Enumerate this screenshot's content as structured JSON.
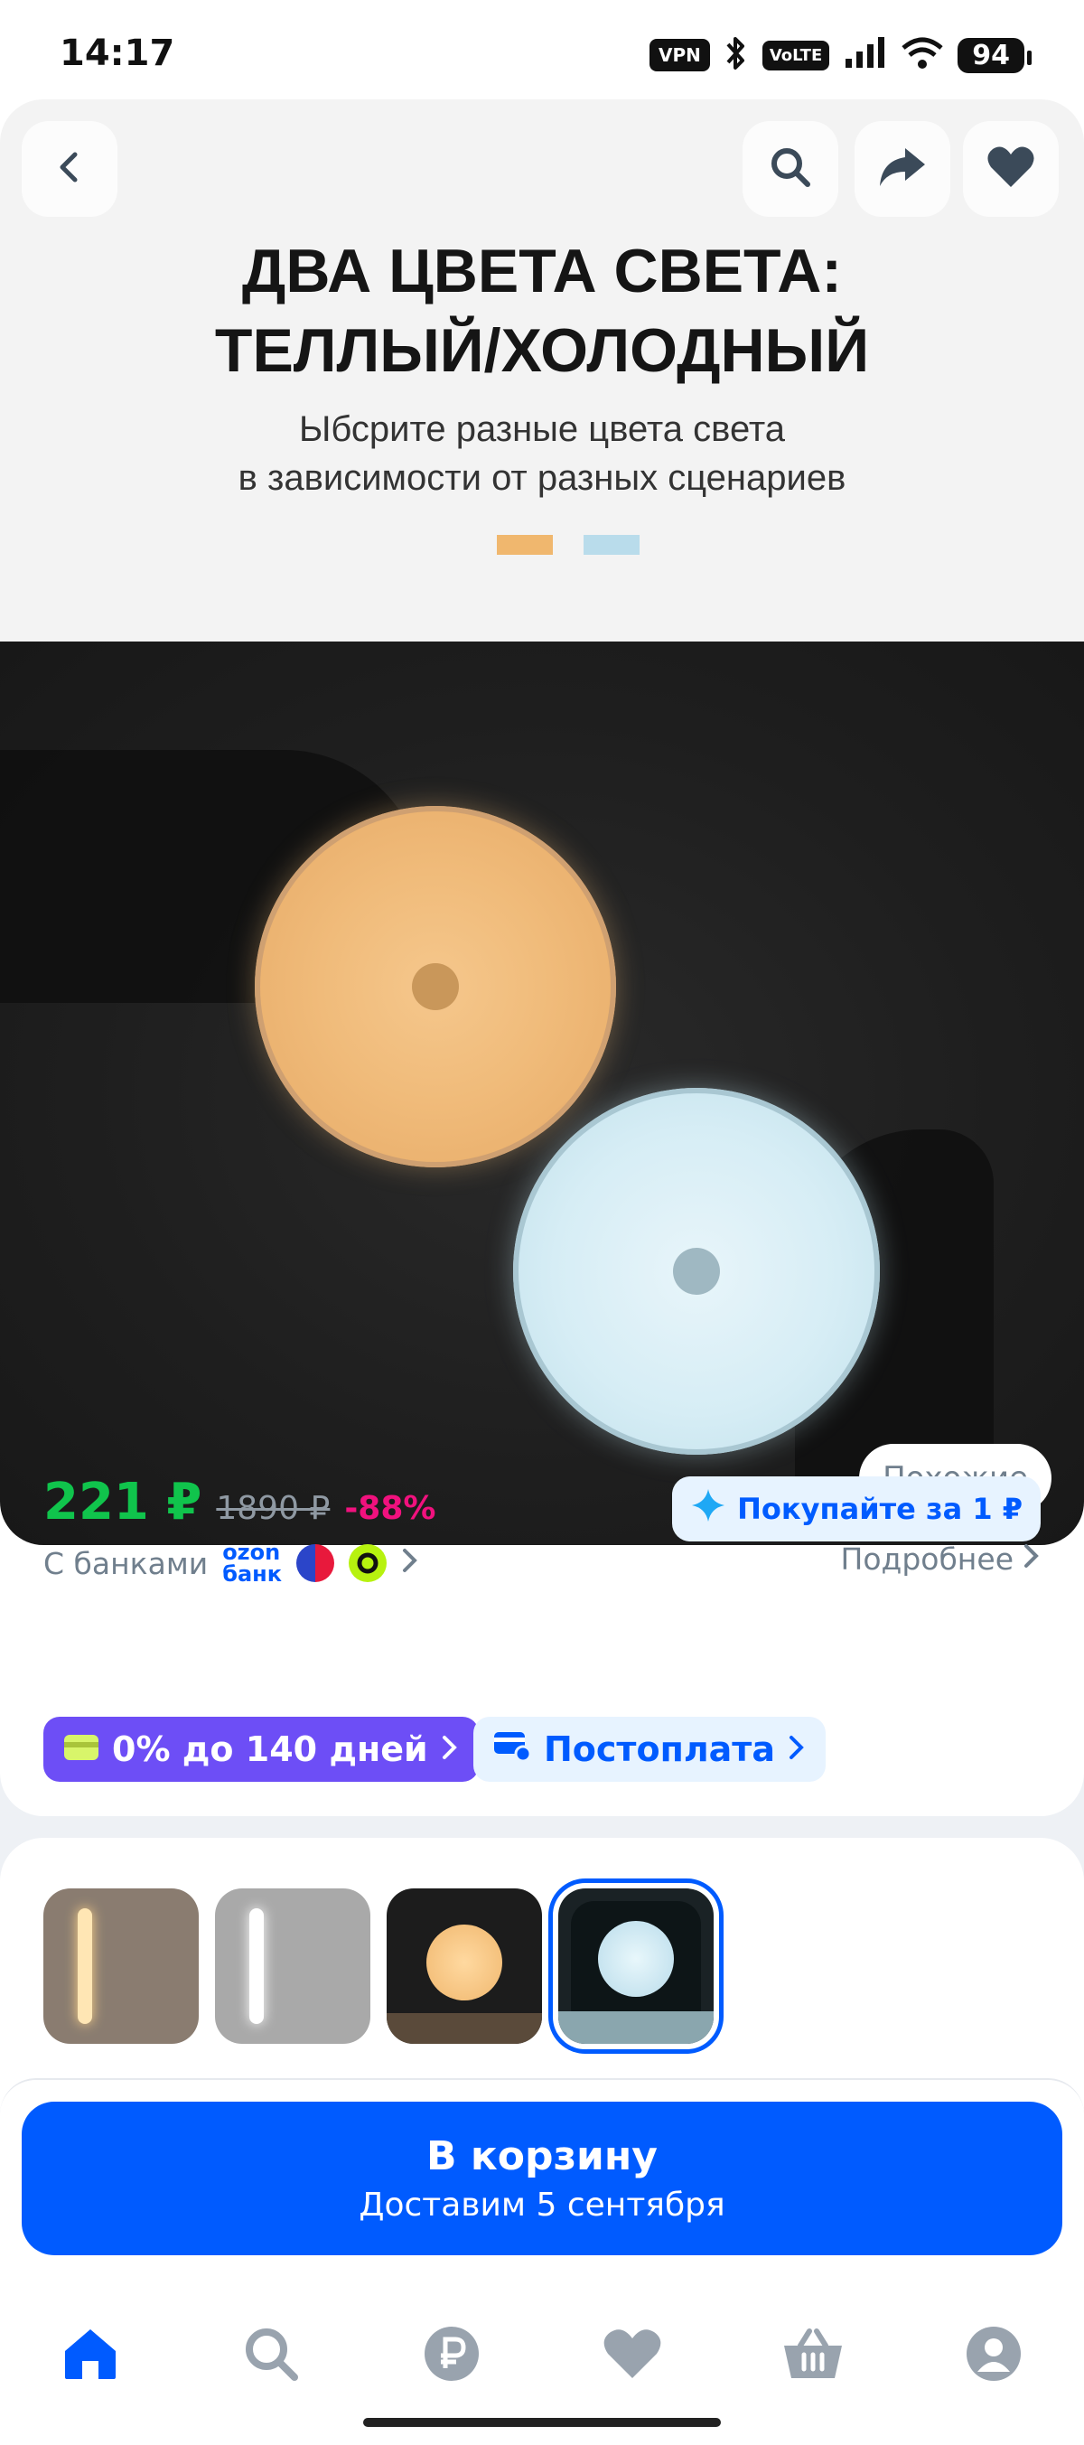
{
  "status_bar": {
    "time": "14:17",
    "vpn": "VPN",
    "volte": "VoLTE",
    "battery": "94",
    "icons": [
      "bluetooth-icon",
      "signal-icon",
      "wifi-icon"
    ]
  },
  "gallery": {
    "headline_line1": "ДВА ЦВЕТА СВЕТА:",
    "headline_line2": "ТЕЛЛЫЙ/ХОЛОДНЫЙ",
    "sub_line1": "Ыбсрите разные цвета света",
    "sub_line2": "в зависимости от разных сценариев",
    "swatch_colors": [
      "#f0b76e",
      "#b9dceb"
    ],
    "similar_label": "Похожие",
    "buttons": [
      "back-icon",
      "search-icon",
      "share-icon",
      "heart-icon"
    ]
  },
  "price": {
    "current": "221 ₽",
    "old": "1890 ₽",
    "discount": "-88%",
    "promo": "Покупайте за 1 ₽",
    "banks_label": "С банками",
    "ozon_bank_line1": "ozon",
    "ozon_bank_line2": "банк",
    "more_label": "Подробнее",
    "installment_label": "0% до 140 дней",
    "postpay_label": "Постоплата"
  },
  "variants": {
    "items": [
      "warm-bar",
      "cool-bar",
      "warm-disc",
      "cool-disc"
    ],
    "selected_index": 3
  },
  "cart": {
    "title": "В корзину",
    "subtitle": "Доставим 5 сентября"
  },
  "bottom_nav": {
    "items": [
      "home-icon",
      "search-icon",
      "ruble-icon",
      "heart-icon",
      "basket-icon",
      "profile-icon"
    ],
    "active": "home-icon"
  },
  "colors": {
    "accent": "#005bff",
    "price_green": "#10c44c",
    "discount_pink": "#f1117e",
    "installment_purple": "#6d4ef6"
  }
}
